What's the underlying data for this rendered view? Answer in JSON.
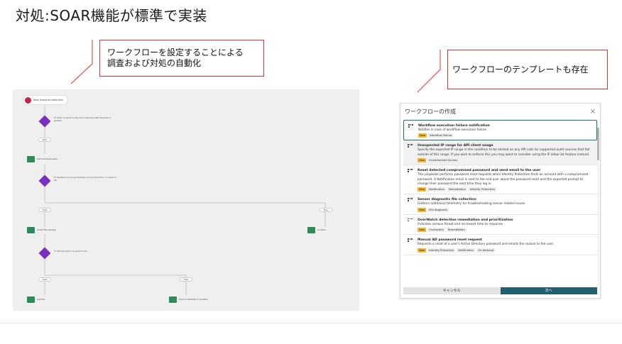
{
  "title": "対処:SOAR機能が標準で実装",
  "callouts": {
    "workflow": "ワークフローを設定することによる\n調査および対処の自動化",
    "template": "ワークフローのテンプレートも存在"
  },
  "workflow": {
    "trigger": "New endpoint detection",
    "cond1": "IF Tactic is equal to Machine Learning AND Severity is greater",
    "branch1": "Next",
    "action1": "Get members quite",
    "cond2": "IF Sandbox score percentage count is less than or equal to 80",
    "branch2a": "Next",
    "branch2b": "Else",
    "action2a": "Check file sample",
    "action2b": "Contain",
    "cond3": "IF Sample action is equal to No",
    "branch3a": "Next",
    "branch3b": "Else",
    "action3a": "Get file",
    "action3b": "Launch SHA256 in sandbox"
  },
  "dialog": {
    "title": "ワークフローの作成",
    "close": "×",
    "items": [
      {
        "name": "Workflow execution failure notification",
        "desc": "Notifies in case of workflow execution failure",
        "tags": [
          "New",
          "Workflow Failure"
        ]
      },
      {
        "name": "Unexpected IP range for API client usage",
        "desc": "Specify the expected IP range in the condition to be alerted on any API calls for supported audit sources that fall outside of this range. If you wish to enforce this you may want to consider using the IP allow list feature instead.",
        "tags": [
          "New",
          "Unauthorized Access"
        ]
      },
      {
        "name": "Reset detected compromised password and send email to the user",
        "desc": "This playbook performs password reset requests when Identity Protection finds an account with a compromised password. A Notification email is sent to the end user about the password reset and the expected prompt to change their password the next time they log in.",
        "tags": [
          "New",
          "Notification",
          "Remediation",
          "Identity Protection"
        ]
      },
      {
        "name": "Sensor diagnostic file collection",
        "desc": "Gathers additional telemetry for troubleshooting sensor related issues",
        "tags": [
          "New",
          "File diagnosis"
        ]
      },
      {
        "name": "OverWatch detection remediation and prioritization",
        "desc": "Indicates serious threat and increased time to response",
        "tags": [
          "New",
          "Overwatch",
          "Remediation"
        ]
      },
      {
        "name": "Manual AD password reset request",
        "desc": "Requests a reset of a user's Active Directory password and emails the reason to the user.",
        "tags": [
          "New",
          "Identity Protection",
          "Notification",
          "On-demand"
        ]
      }
    ],
    "cancel": "キャンセル",
    "next": "次へ"
  },
  "colors": {
    "callout_border": "#dd3333",
    "accent": "#1f5f6e",
    "new_tag": "#f6b93b",
    "condition": "#7b2fbe",
    "action": "#2e8b57",
    "trigger": "#c0284b"
  }
}
